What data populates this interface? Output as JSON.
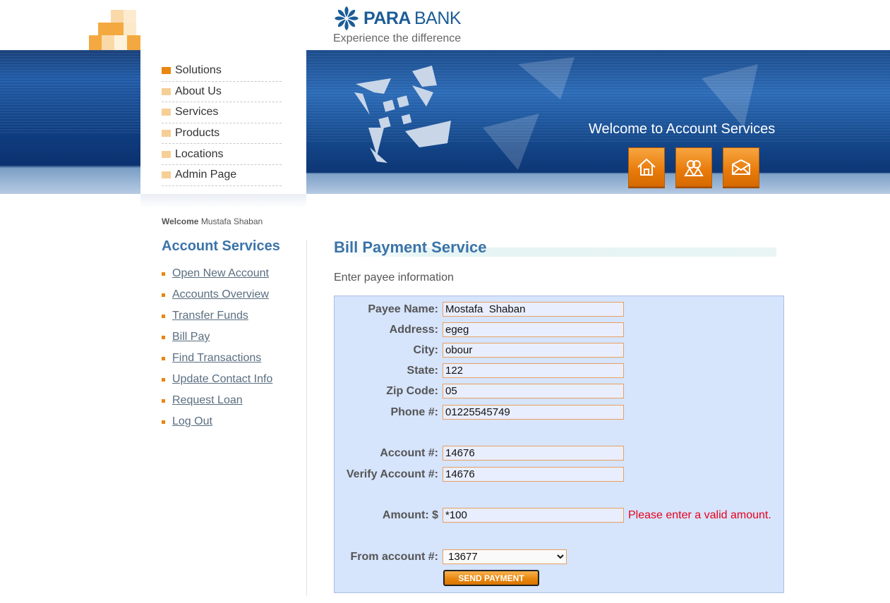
{
  "brand": {
    "name_bold": "PARA",
    "name_light": "BANK",
    "tagline": "Experience the difference",
    "colors": {
      "primary_blue": "#1b5c96",
      "accent_orange": "#e8860f"
    }
  },
  "top_menu": {
    "items": [
      {
        "label": "Solutions",
        "active": true
      },
      {
        "label": "About Us"
      },
      {
        "label": "Services"
      },
      {
        "label": "Products"
      },
      {
        "label": "Locations"
      },
      {
        "label": "Admin Page"
      }
    ]
  },
  "banner": {
    "title": "Welcome to Account Services",
    "buttons": [
      {
        "icon": "home-icon"
      },
      {
        "icon": "about-icon"
      },
      {
        "icon": "contact-envelope-icon"
      }
    ]
  },
  "sidebar": {
    "welcome_label": "Welcome",
    "welcome_user": "Mustafa Shaban",
    "title": "Account Services",
    "links": [
      "Open New Account",
      "Accounts Overview",
      "Transfer Funds",
      "Bill Pay",
      "Find Transactions",
      "Update Contact Info",
      "Request Loan",
      "Log Out"
    ]
  },
  "main": {
    "title": "Bill Payment Service",
    "subtitle": "Enter payee information",
    "form": {
      "payee_name": {
        "label": "Payee Name:",
        "value": "Mostafa  Shaban"
      },
      "address": {
        "label": "Address:",
        "value": "egeg"
      },
      "city": {
        "label": "City:",
        "value": "obour"
      },
      "state": {
        "label": "State:",
        "value": "122"
      },
      "zip": {
        "label": "Zip Code:",
        "value": "05"
      },
      "phone": {
        "label": "Phone #:",
        "value": "01225545749"
      },
      "account": {
        "label": "Account #:",
        "value": "14676"
      },
      "verify_account": {
        "label": "Verify Account #:",
        "value": "14676"
      },
      "amount": {
        "label": "Amount: $",
        "value": "*100",
        "error": "Please enter a valid amount."
      },
      "from_account": {
        "label": "From account #:",
        "selected": "13677"
      },
      "submit_label": "SEND PAYMENT"
    }
  }
}
